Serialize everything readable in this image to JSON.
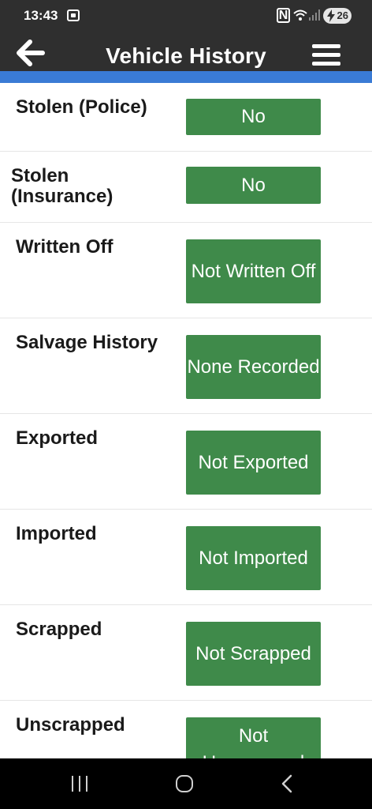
{
  "status": {
    "time": "13:43",
    "nfc": "N",
    "battery": "26"
  },
  "header": {
    "title": "Vehicle History"
  },
  "rows": [
    {
      "label": "Stolen (Police)",
      "value": "No"
    },
    {
      "label": "Stolen (Insurance)",
      "value": "No"
    },
    {
      "label": "Written Off",
      "value": "Not Written Off"
    },
    {
      "label": "Salvage History",
      "value": "None Recorded"
    },
    {
      "label": "Exported",
      "value": "Not Exported"
    },
    {
      "label": "Imported",
      "value": "Not Imported"
    },
    {
      "label": "Scrapped",
      "value": "Not Scrapped"
    },
    {
      "label": "Unscrapped",
      "value": "Not Unscrapped"
    }
  ],
  "icons": {
    "back": "back-arrow-icon",
    "menu": "hamburger-menu-icon",
    "screenshot": "screenshot-icon",
    "wifi": "wifi-icon",
    "signal": "signal-icon",
    "nav_recent": "recent-apps-icon",
    "nav_home": "home-icon",
    "nav_back": "back-chevron-icon"
  },
  "colors": {
    "header_bg": "#2f2f2f",
    "accent_strip": "#3a7bd5",
    "value_bg": "#3f8a4a",
    "value_text": "#ffffff"
  }
}
